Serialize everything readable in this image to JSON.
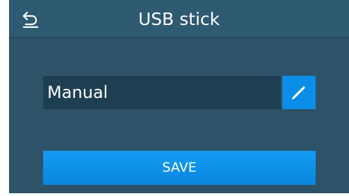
{
  "header": {
    "title": "USB stick",
    "back_icon": "back-arrow-icon"
  },
  "form": {
    "name_value": "Manual",
    "edit_icon": "pencil-icon"
  },
  "actions": {
    "save_label": "SAVE"
  },
  "colors": {
    "background": "#2e5368",
    "header": "#2e5a72",
    "field": "#1e3e52",
    "accent": "#0a8ee8"
  }
}
